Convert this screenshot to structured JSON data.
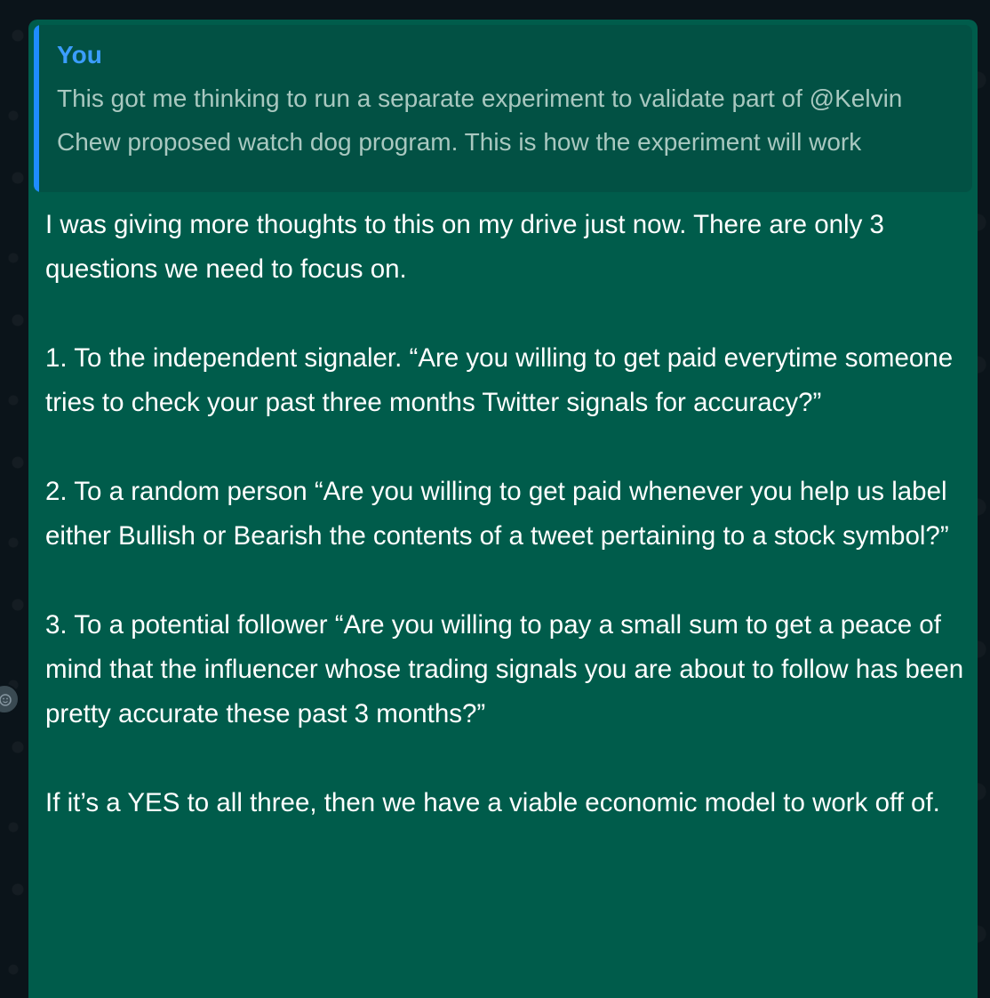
{
  "quoted_message": {
    "author": "You",
    "text": "This got me thinking to run a separate experiment to validate part of @Kelvin Chew proposed watch dog program. This is how the experiment will work"
  },
  "message": {
    "paragraphs": [
      "I was giving more thoughts to this on my drive just now. There are only 3 questions we need to focus on.",
      "1. To the independent signaler. “Are you willing to get paid everytime someone tries to check your past three months Twitter signals for accuracy?”",
      "2. To a random person “Are you willing to get paid whenever you help us label either Bullish or Bearish the contents of a tweet pertaining to a stock symbol?”",
      "3. To a potential follower “Are you willing to pay a small sum to get a peace of mind that the influencer whose trading signals you are about to follow has been pretty accurate these past 3 months?”",
      "If it’s a YES to all three, then we have a viable economic model to work off of."
    ]
  },
  "colors": {
    "bubble": "#005c4b",
    "quote_bg": "#025144",
    "quote_accent": "#1e8cff",
    "background": "#0b141a"
  },
  "icons": {
    "side_handle": "reaction-emoji-icon"
  }
}
